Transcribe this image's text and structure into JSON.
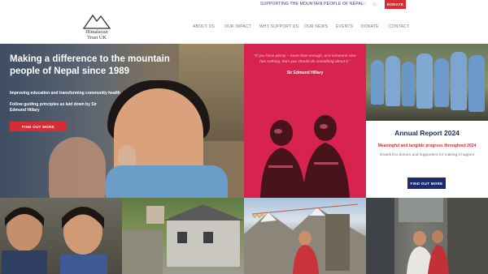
{
  "topbar": {
    "tagline": "SUPPORTING THE MOUNTAIN PEOPLE OF NEPAL",
    "donate": "DONATE",
    "social": [
      "email-icon",
      "facebook-icon",
      "linkedin-icon",
      "instagram-icon"
    ]
  },
  "brand": {
    "line1": "Himalayan",
    "line2": "Trust UK"
  },
  "nav": [
    "ABOUT US",
    "OUR IMPACT",
    "WHY SUPPORT US",
    "OUR NEWS",
    "EVENTS",
    "DONATE",
    "CONTACT"
  ],
  "hero": {
    "title": "Making a difference to the mountain people of Nepal since 1989",
    "line1": "Improving education and transforming community health",
    "line2": "Follow guiding principles as laid down by Sir Edmund Hillary",
    "button": "FIND OUT MORE"
  },
  "quote": {
    "text": "\"If you have plenty – more than enough, and someone else has nothing, then you should do something about it.\"",
    "author": "Sir Edmund Hillary"
  },
  "report": {
    "title": "Annual Report 2024",
    "subtitle": "Meaningful and tangible progress throughout 2024",
    "text": "Grateful to donors and supporters for making it happen",
    "button": "FIND OUT MORE"
  },
  "colors": {
    "brand_red": "#d62c33",
    "quote_pink": "#d8234e",
    "navy": "#1e2c6b"
  }
}
